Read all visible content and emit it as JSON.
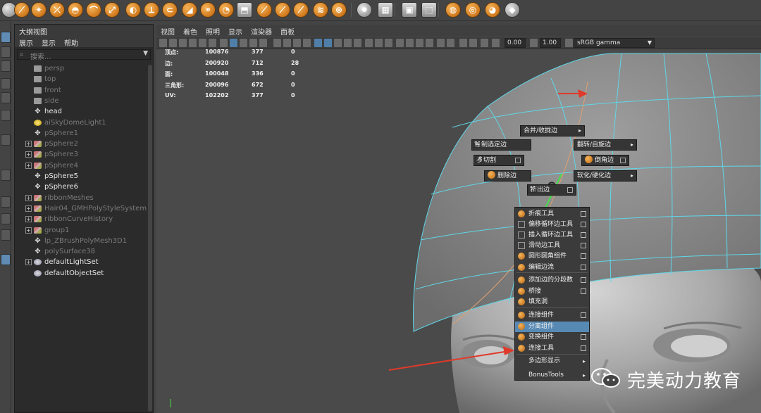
{
  "shelf": {
    "buttons": [
      "create-sphere",
      "create-cube",
      "create-cylinder",
      "create-cone",
      "create-torus",
      "create-plane",
      "sweep-mesh",
      "combine",
      "separate",
      "boolean",
      "smooth",
      "average",
      "bridge",
      "extrude",
      "append",
      "bevel",
      "multi-cut",
      "target-weld",
      "merge",
      "soft-mod",
      "uv-layout",
      "uv-editor",
      "display-layer",
      "xray",
      "isolate",
      "texture",
      "checker"
    ]
  },
  "outliner": {
    "title": "大纲视图",
    "menu": [
      "展示",
      "显示",
      "帮助"
    ],
    "search_placeholder": "搜索...",
    "items": [
      {
        "label": "persp",
        "icon": "camera-icon",
        "state": "dim"
      },
      {
        "label": "top",
        "icon": "camera-icon",
        "state": "dim"
      },
      {
        "label": "front",
        "icon": "camera-icon",
        "state": "dim"
      },
      {
        "label": "side",
        "icon": "camera-icon",
        "state": "dim"
      },
      {
        "label": "head",
        "icon": "transform-icon",
        "state": "bright"
      },
      {
        "label": "aiSkyDomeLight1",
        "icon": "light-icon",
        "state": "dim"
      },
      {
        "label": "pSphere1",
        "icon": "transform-icon",
        "state": "dim"
      },
      {
        "label": "pSphere2",
        "icon": "mesh-icon",
        "state": "dim",
        "expand": "+"
      },
      {
        "label": "pSphere3",
        "icon": "mesh-icon",
        "state": "dim",
        "expand": "+"
      },
      {
        "label": "pSphere4",
        "icon": "mesh-icon",
        "state": "dim",
        "expand": "+"
      },
      {
        "label": "pSphere5",
        "icon": "transform-icon",
        "state": "bright"
      },
      {
        "label": "pSphere6",
        "icon": "transform-icon",
        "state": "bright"
      },
      {
        "label": "ribbonMeshes",
        "icon": "mesh-icon",
        "state": "dim",
        "expand": "+"
      },
      {
        "label": "Hair04_GMHPolyStyleSystem",
        "icon": "group-icon",
        "state": "dim",
        "expand": "+"
      },
      {
        "label": "ribbonCurveHistory",
        "icon": "mesh-icon",
        "state": "dim",
        "expand": "+"
      },
      {
        "label": "group1",
        "icon": "mesh-icon",
        "state": "dim",
        "expand": "+"
      },
      {
        "label": "lp_ZBrushPolyMesh3D1",
        "icon": "transform-icon",
        "state": "dim"
      },
      {
        "label": "polySurface38",
        "icon": "transform-icon",
        "state": "dim"
      },
      {
        "label": "defaultLightSet",
        "icon": "set-icon",
        "state": "bright",
        "expand": "+"
      },
      {
        "label": "defaultObjectSet",
        "icon": "set-icon",
        "state": "bright"
      }
    ]
  },
  "viewport": {
    "menu": [
      "视图",
      "着色",
      "照明",
      "显示",
      "渲染器",
      "面板"
    ],
    "exposure": "0.00",
    "gamma": "1.00",
    "color_space": "sRGB gamma",
    "hud": [
      {
        "label": "顶点:",
        "a": "100876",
        "b": "377",
        "c": "0"
      },
      {
        "label": "边:",
        "a": "200920",
        "b": "712",
        "c": "28"
      },
      {
        "label": "面:",
        "a": "100048",
        "b": "336",
        "c": "0"
      },
      {
        "label": "三角形:",
        "a": "200096",
        "b": "672",
        "c": "0"
      },
      {
        "label": "UV:",
        "a": "102202",
        "b": "377",
        "c": "0"
      }
    ]
  },
  "marking_menu": {
    "north": "合并/收拢边",
    "northwest": "绘制选定边",
    "northeast": "翻转/自旋边",
    "west": "多切割",
    "east": "倒角边",
    "southwest": "删除边",
    "southeast": "软化/硬化边",
    "south": "挤出边"
  },
  "context_menu": {
    "items": [
      {
        "label": "折痕工具",
        "box": true
      },
      {
        "label": "偏移循环边工具",
        "box": true
      },
      {
        "label": "插入循环边工具",
        "box": true
      },
      {
        "label": "滑动边工具",
        "box": true
      },
      {
        "label": "圆形圆角组件",
        "box": true
      },
      {
        "label": "编辑边流",
        "box": true
      },
      {
        "label": "添加边的分段数",
        "box": true
      },
      {
        "label": "桥接",
        "box": true
      },
      {
        "label": "填充洞",
        "box": false
      },
      {
        "label": "连接组件",
        "box": true
      },
      {
        "label": "分离组件",
        "box": false,
        "highlight": true
      },
      {
        "label": "变换组件",
        "box": true
      },
      {
        "label": "连接工具",
        "box": true
      },
      {
        "label": "多边形显示",
        "submenu": true
      },
      {
        "label": "BonusTools",
        "submenu": true
      }
    ]
  },
  "watermark": {
    "text": "完美动力教育"
  },
  "colors": {
    "accent": "#5689b4",
    "wire": "#5fd7e8",
    "annotation": "#e03a2a"
  }
}
